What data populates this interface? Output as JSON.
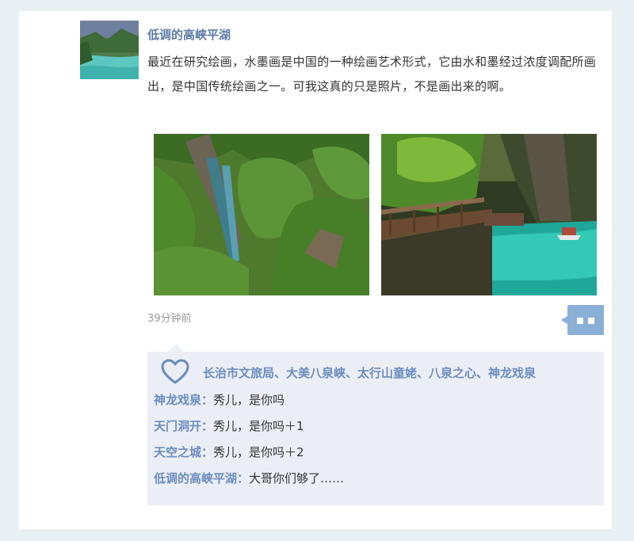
{
  "post": {
    "author": "低调的高峡平湖",
    "content": "最近在研究绘画，水墨画是中国的一种绘画艺术形式，它由水和墨经过浓度调配所画出，是中国传统绘画之一。可我这真的只是照片，不是画出来的啊。",
    "time": "39分钟前"
  },
  "likes": {
    "icon": "heart-outline-icon",
    "names": "长治市文旅局、大美八泉峡、太行山童姥、八泉之心、神龙戏泉"
  },
  "comments": [
    {
      "name": "神龙戏泉",
      "sep": "：",
      "text": "秀儿，是你吗"
    },
    {
      "name": "天门洞开",
      "sep": "：",
      "text": "秀儿，是你吗＋1"
    },
    {
      "name": "天空之城",
      "sep": "：",
      "text": "秀儿，是你吗＋2"
    },
    {
      "name": "低调的高峡平湖",
      "sep": "：",
      "text": "大哥你们够了……"
    }
  ],
  "colors": {
    "accent": "#5a7ba8",
    "comment_button": "#8aafd4",
    "reply_background": "#eceef6"
  }
}
